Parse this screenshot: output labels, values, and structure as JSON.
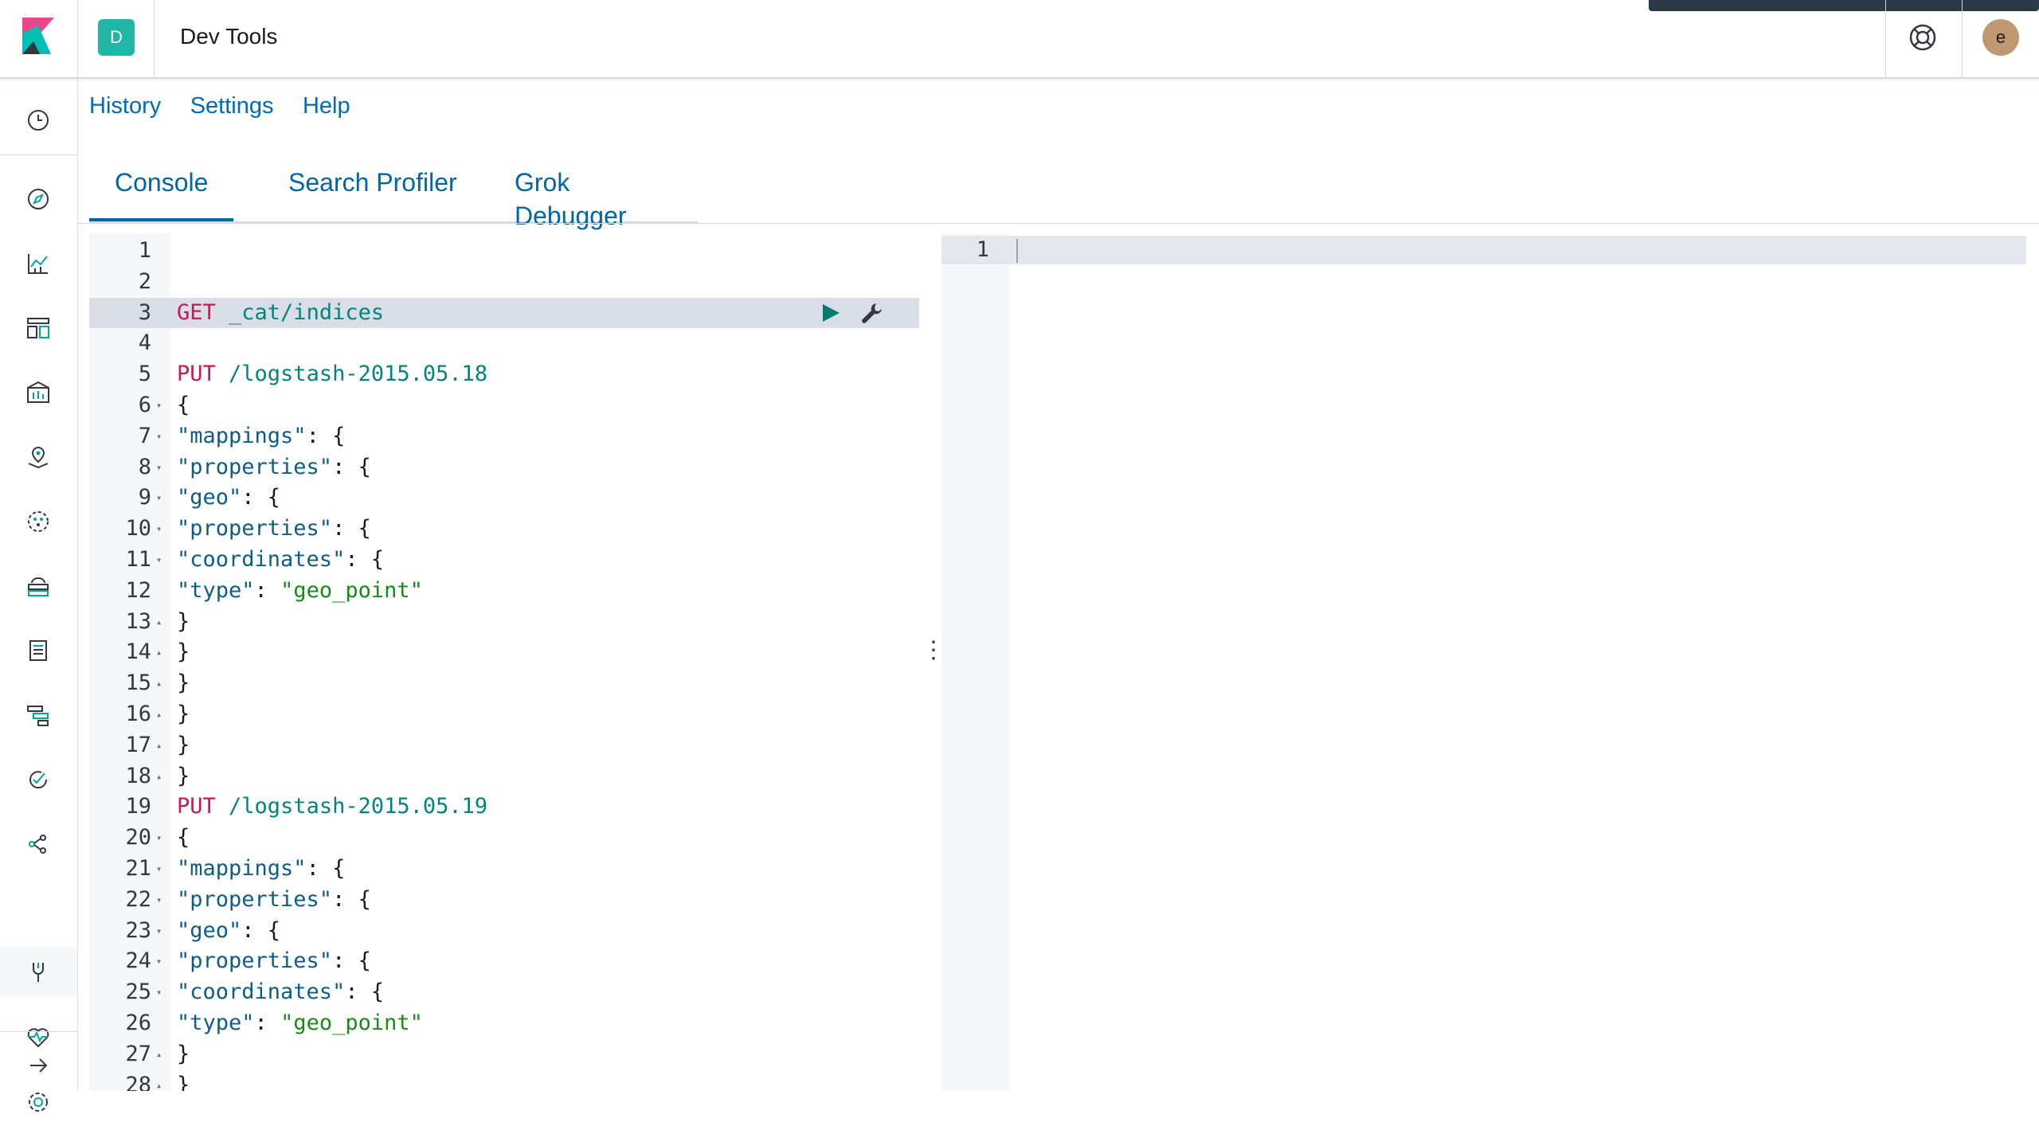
{
  "app": {
    "title": "Dev Tools",
    "space_initial": "D",
    "user_initial": "e"
  },
  "subnav": [
    "History",
    "Settings",
    "Help"
  ],
  "tabs": [
    {
      "label": "Console",
      "active": true
    },
    {
      "label": "Search Profiler",
      "active": false
    },
    {
      "label": "Grok Debugger",
      "active": false
    }
  ],
  "nav_icons": [
    "clock-icon",
    "compass-icon",
    "chart-icon",
    "dashboard-icon",
    "canvas-icon",
    "maps-icon",
    "ml-icon",
    "infra-icon",
    "logs-icon",
    "apm-icon",
    "uptime-icon",
    "graph-icon",
    "devtools-icon",
    "monitoring-icon",
    "settings-icon",
    "collapse-icon"
  ],
  "editor": {
    "highlight_line": 3,
    "lines": [
      {
        "n": "1",
        "t": []
      },
      {
        "n": "2",
        "t": []
      },
      {
        "n": "3",
        "t": [
          [
            "m",
            "GET "
          ],
          [
            "u",
            "_cat/indices"
          ]
        ]
      },
      {
        "n": "4",
        "t": []
      },
      {
        "n": "5",
        "t": [
          [
            "m",
            "PUT "
          ],
          [
            "u",
            "/logstash-2015.05.18"
          ]
        ]
      },
      {
        "n": "6",
        "f": "▾",
        "t": [
          [
            "p",
            "{"
          ]
        ]
      },
      {
        "n": "7",
        "f": "▾",
        "t": [
          [
            "k",
            "\"mappings\""
          ],
          [
            "p",
            ": {"
          ]
        ]
      },
      {
        "n": "8",
        "f": "▾",
        "t": [
          [
            "k",
            "\"properties\""
          ],
          [
            "p",
            ": {"
          ]
        ]
      },
      {
        "n": "9",
        "f": "▾",
        "t": [
          [
            "k",
            "\"geo\""
          ],
          [
            "p",
            ": {"
          ]
        ]
      },
      {
        "n": "10",
        "f": "▾",
        "t": [
          [
            "k",
            "\"properties\""
          ],
          [
            "p",
            ": {"
          ]
        ]
      },
      {
        "n": "11",
        "f": "▾",
        "t": [
          [
            "k",
            "\"coordinates\""
          ],
          [
            "p",
            ": {"
          ]
        ]
      },
      {
        "n": "12",
        "t": [
          [
            "k",
            "\"type\""
          ],
          [
            "p",
            ": "
          ],
          [
            "s",
            "\"geo_point\""
          ]
        ]
      },
      {
        "n": "13",
        "f": "▴",
        "t": [
          [
            "p",
            "}"
          ]
        ]
      },
      {
        "n": "14",
        "f": "▴",
        "t": [
          [
            "p",
            "}"
          ]
        ]
      },
      {
        "n": "15",
        "f": "▴",
        "t": [
          [
            "p",
            "}"
          ]
        ]
      },
      {
        "n": "16",
        "f": "▴",
        "t": [
          [
            "p",
            "}"
          ]
        ]
      },
      {
        "n": "17",
        "f": "▴",
        "t": [
          [
            "p",
            "}"
          ]
        ]
      },
      {
        "n": "18",
        "f": "▴",
        "t": [
          [
            "p",
            "}"
          ]
        ]
      },
      {
        "n": "19",
        "t": [
          [
            "m",
            "PUT "
          ],
          [
            "u",
            "/logstash-2015.05.19"
          ]
        ]
      },
      {
        "n": "20",
        "f": "▾",
        "t": [
          [
            "p",
            "{"
          ]
        ]
      },
      {
        "n": "21",
        "f": "▾",
        "t": [
          [
            "k",
            "\"mappings\""
          ],
          [
            "p",
            ": {"
          ]
        ]
      },
      {
        "n": "22",
        "f": "▾",
        "t": [
          [
            "k",
            "\"properties\""
          ],
          [
            "p",
            ": {"
          ]
        ]
      },
      {
        "n": "23",
        "f": "▾",
        "t": [
          [
            "k",
            "\"geo\""
          ],
          [
            "p",
            ": {"
          ]
        ]
      },
      {
        "n": "24",
        "f": "▾",
        "t": [
          [
            "k",
            "\"properties\""
          ],
          [
            "p",
            ": {"
          ]
        ]
      },
      {
        "n": "25",
        "f": "▾",
        "t": [
          [
            "k",
            "\"coordinates\""
          ],
          [
            "p",
            ": {"
          ]
        ]
      },
      {
        "n": "26",
        "t": [
          [
            "k",
            "\"type\""
          ],
          [
            "p",
            ": "
          ],
          [
            "s",
            "\"geo_point\""
          ]
        ]
      },
      {
        "n": "27",
        "f": "▴",
        "t": [
          [
            "p",
            "}"
          ]
        ]
      },
      {
        "n": "28",
        "f": "▴",
        "t": [
          [
            "p",
            "}"
          ]
        ]
      }
    ]
  },
  "output": {
    "lines": [
      "1"
    ]
  },
  "colors": {
    "accent": "#006bb8",
    "teal": "#20b5a4",
    "method": "#c41a5b",
    "url": "#00857e",
    "string": "#178c17"
  }
}
